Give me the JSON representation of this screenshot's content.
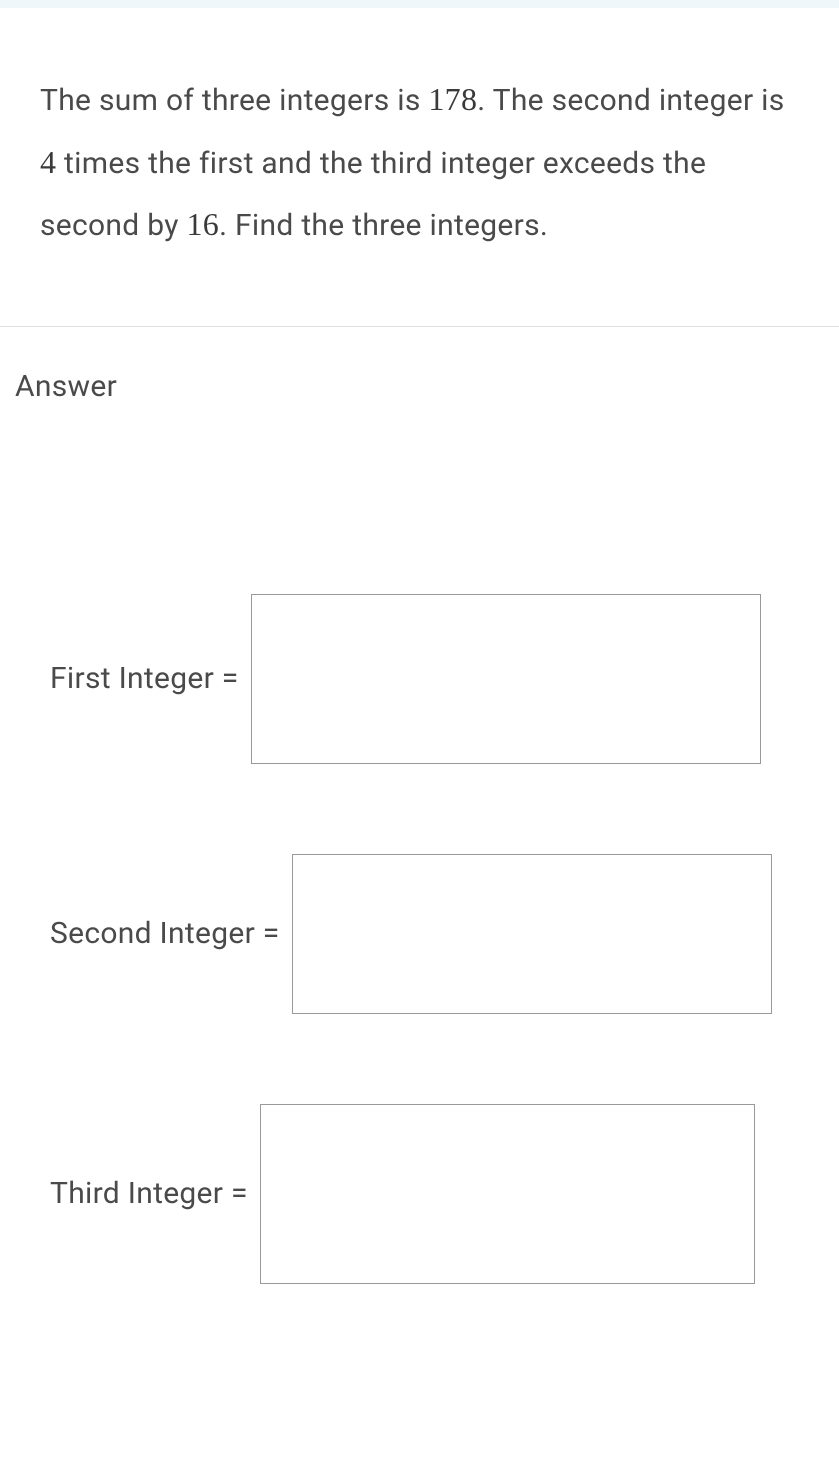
{
  "question": {
    "text_parts": [
      "The sum of three integers is ",
      "178",
      ". The second integer is ",
      "4",
      " times the first and the third integer exceeds the second by ",
      "16",
      ". Find the three integers."
    ]
  },
  "answer": {
    "heading": "Answer",
    "fields": [
      {
        "label": "First Integer =",
        "value": ""
      },
      {
        "label": "Second Integer =",
        "value": ""
      },
      {
        "label": "Third Integer =",
        "value": ""
      }
    ]
  }
}
